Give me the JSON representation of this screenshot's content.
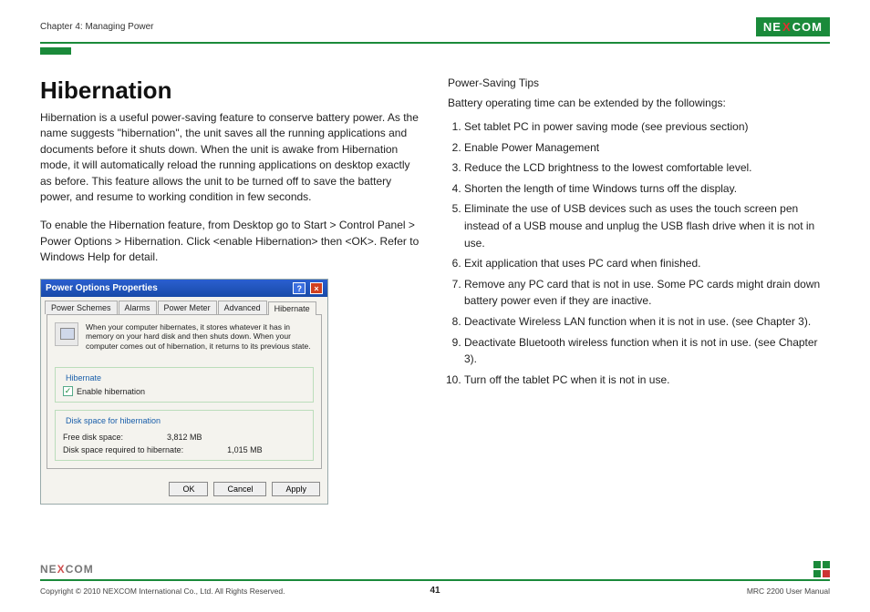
{
  "header": {
    "chapter": "Chapter 4: Managing Power",
    "brand_pre": "NE",
    "brand_x": "X",
    "brand_post": "COM"
  },
  "left": {
    "title": "Hibernation",
    "p1": "Hibernation is a useful power-saving feature to conserve battery power.  As the name suggests \"hibernation\", the unit saves all the running applications and documents before it shuts down. When the unit is awake from Hibernation mode, it will automatically reload the running applications on desktop exactly as before.  This feature allows the unit to be turned off to save the battery power, and resume to working condition in few seconds.",
    "p2": "To enable the Hibernation feature, from Desktop go to Start > Control Panel > Power Options > Hibernation. Click <enable Hibernation> then <OK>. Refer to Windows Help for detail."
  },
  "dialog": {
    "title": "Power Options Properties",
    "tabs": [
      "Power Schemes",
      "Alarms",
      "Power Meter",
      "Advanced",
      "Hibernate"
    ],
    "desc": "When your computer hibernates, it stores whatever it has in memory on your hard disk and then shuts down. When your computer comes out of hibernation, it returns to its previous state.",
    "group_hib": "Hibernate",
    "chk_label": "Enable hibernation",
    "group_disk": "Disk space for hibernation",
    "free_label": "Free disk space:",
    "free_val": "3,812 MB",
    "req_label": "Disk space required to hibernate:",
    "req_val": "1,015 MB",
    "ok": "OK",
    "cancel": "Cancel",
    "apply": "Apply"
  },
  "right": {
    "tips_title": "Power-Saving Tips",
    "intro": "Battery operating time can be extended by the followings:",
    "tips": [
      "Set tablet PC in power saving mode (see previous section)",
      "Enable Power Management",
      "Reduce the LCD brightness to the lowest comfortable level.",
      "Shorten the length of time Windows turns off the display.",
      "Eliminate the use of USB devices such as uses the touch screen pen instead of a USB mouse and unplug the USB flash drive when it is not in use.",
      "Exit application that uses PC card when finished.",
      "Remove any PC card that is not in use. Some PC cards might drain down battery power even if they are inactive.",
      "Deactivate Wireless LAN function when it is not in use. (see Chapter 3).",
      "Deactivate Bluetooth wireless function when it is not in use. (see Chapter 3).",
      "Turn off the tablet PC when it is not in use."
    ]
  },
  "footer": {
    "copyright": "Copyright © 2010 NEXCOM International Co., Ltd. All Rights Reserved.",
    "page": "41",
    "docref": "MRC 2200 User Manual"
  }
}
